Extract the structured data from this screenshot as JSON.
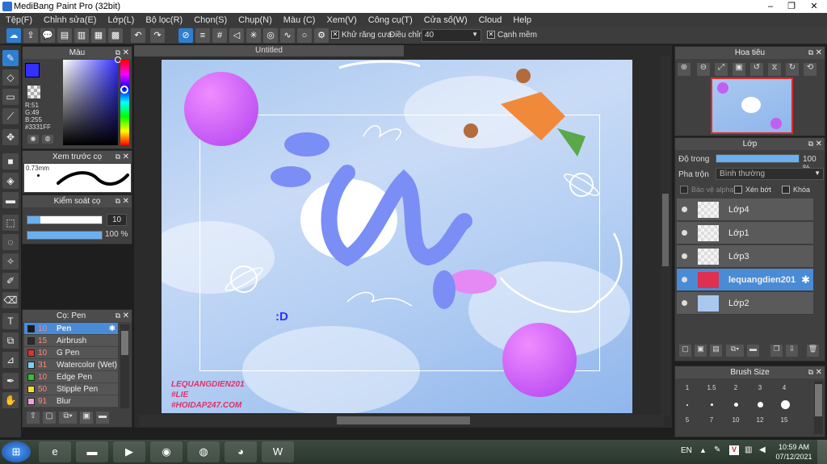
{
  "window": {
    "title": "MediBang Paint Pro (32bit)"
  },
  "menu": [
    "Tệp(F)",
    "Chỉnh sửa(E)",
    "Lớp(L)",
    "Bộ lọc(R)",
    "Chọn(S)",
    "Chụp(N)",
    "Màu (C)",
    "Xem(V)",
    "Công cụ(T)",
    "Cửa số(W)",
    "Cloud",
    "Help"
  ],
  "toolbar": {
    "antialias_label": "Khử răng cưa",
    "adjust_label": "Điều chỉnh",
    "adjust_value": "40",
    "edge_label": "Cạnh mềm"
  },
  "color_panel": {
    "title": "Màu",
    "r": "R:51",
    "g": "G:49",
    "b": "B:255",
    "hex": "#3331FF",
    "primary": "#3331ff",
    "secondary": "#ffffff"
  },
  "brush_preview": {
    "title": "Xem trước cọ",
    "size": "0.73mm"
  },
  "brush_control": {
    "title": "Kiểm soát cọ",
    "size": "10",
    "opacity": "100 %"
  },
  "brushes": {
    "title": "Cọ: Pen",
    "items": [
      {
        "size": "10",
        "name": "Pen",
        "color": "#1a1a1a"
      },
      {
        "size": "15",
        "name": "Airbrush",
        "color": "#2b2b2b"
      },
      {
        "size": "10",
        "name": "G Pen",
        "color": "#e03030"
      },
      {
        "size": "31",
        "name": "Watercolor (Wet)",
        "color": "#7ad0f0"
      },
      {
        "size": "10",
        "name": "Edge Pen",
        "color": "#30c030"
      },
      {
        "size": "50",
        "name": "Stipple Pen",
        "color": "#f0e030"
      },
      {
        "size": "91",
        "name": "Blur",
        "color": "#f0a0e0"
      }
    ]
  },
  "canvas": {
    "tab_title": "Untitled",
    "watermark": [
      "LEQUANGDIEN201",
      "#LIE",
      "#HOIDAP247.COM"
    ],
    "text_d": ":D"
  },
  "navigator": {
    "title": "Hoa tiêu"
  },
  "layer_panel": {
    "title": "Lớp",
    "opacity_label": "Độ trong",
    "opacity_value": "100 %",
    "opacity_fraction": 1.0,
    "blend_label": "Pha trộn",
    "blend_value": "Bình thường",
    "protect_alpha": "Bảo vệ alpha",
    "clip": "Xén bớt",
    "lock": "Khóa",
    "layers": [
      {
        "name": "Lớp4"
      },
      {
        "name": "Lớp1"
      },
      {
        "name": "Lớp3"
      },
      {
        "name": "lequangdien201",
        "selected": true
      },
      {
        "name": "Lớp2"
      }
    ]
  },
  "brush_size": {
    "title": "Brush Size",
    "row1": [
      "1",
      "1.5",
      "2",
      "3",
      "4"
    ],
    "row2": [
      "5",
      "7",
      "10",
      "12",
      "15"
    ]
  },
  "taskbar": {
    "lang": "EN",
    "time": "10:59 AM",
    "date": "07/12/2021"
  }
}
